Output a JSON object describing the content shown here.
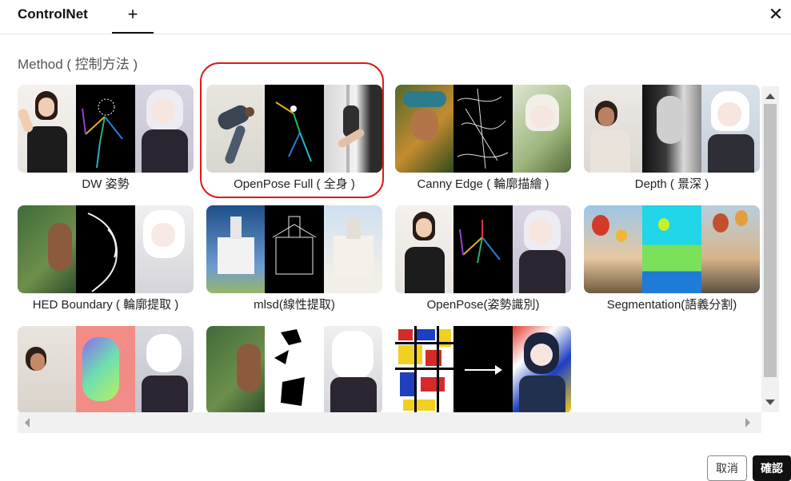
{
  "header": {
    "tab_label": "ControlNet",
    "add_tab": "+",
    "close": "✕"
  },
  "section_label": "Method ( 控制方法 )",
  "methods": [
    {
      "label": "DW 姿勢"
    },
    {
      "label": "OpenPose Full ( 全身 )"
    },
    {
      "label": "Canny Edge ( 輪廓描繪 )"
    },
    {
      "label": "Depth ( 景深 )"
    },
    {
      "label": "HED Boundary ( 輪廓提取 )"
    },
    {
      "label": "mlsd(線性提取)"
    },
    {
      "label": "OpenPose(姿勢識別)"
    },
    {
      "label": "Segmentation(語義分割)"
    },
    {
      "label": ""
    },
    {
      "label": ""
    },
    {
      "label": ""
    }
  ],
  "footer": {
    "cancel_label": "取消",
    "confirm_label": "確認"
  },
  "colors": {
    "highlight": "#e0191b",
    "confirm_bg": "#111111"
  }
}
